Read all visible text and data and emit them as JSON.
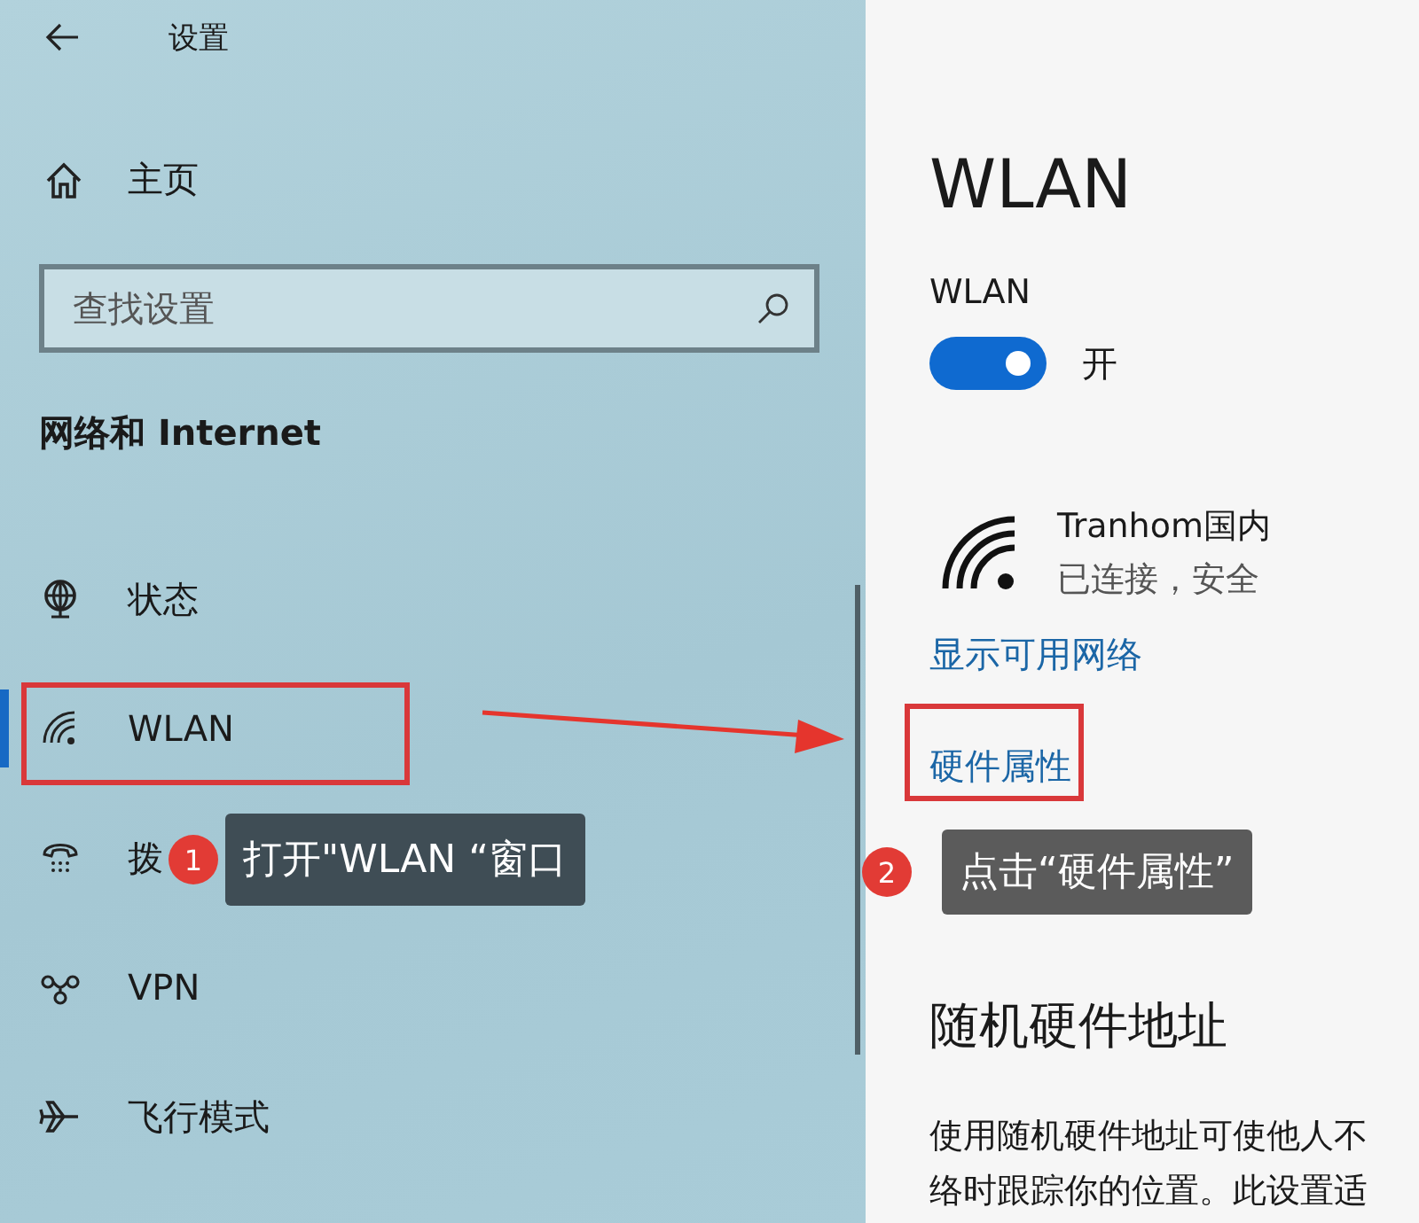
{
  "header": {
    "title": "设置"
  },
  "home": {
    "label": "主页"
  },
  "search": {
    "placeholder": "查找设置"
  },
  "section_title": "网络和 Internet",
  "nav_items": [
    {
      "label": "状态",
      "kind": "globe",
      "selected": false
    },
    {
      "label": "WLAN",
      "kind": "wifi",
      "selected": true
    },
    {
      "label": "拨",
      "kind": "dialup",
      "selected": false
    },
    {
      "label": "VPN",
      "kind": "vpn",
      "selected": false
    },
    {
      "label": "飞行模式",
      "kind": "airplane",
      "selected": false
    }
  ],
  "page_title": "WLAN",
  "wifi_label": "WLAN",
  "wifi_toggle": {
    "on": true,
    "label": "开"
  },
  "network": {
    "name": "Tranhom国内",
    "status": "已连接，安全"
  },
  "links": [
    "显示可用网络",
    "硬件属性"
  ],
  "random_section": {
    "title": "随机硬件地址",
    "lines": [
      "使用随机硬件地址可使他人不",
      "络时跟踪你的位置。此设置适"
    ]
  },
  "annotations": [
    {
      "number": "1",
      "text": "打开\"WLAN “窗口"
    },
    {
      "number": "2",
      "text": "点击“硬件属性”"
    }
  ]
}
